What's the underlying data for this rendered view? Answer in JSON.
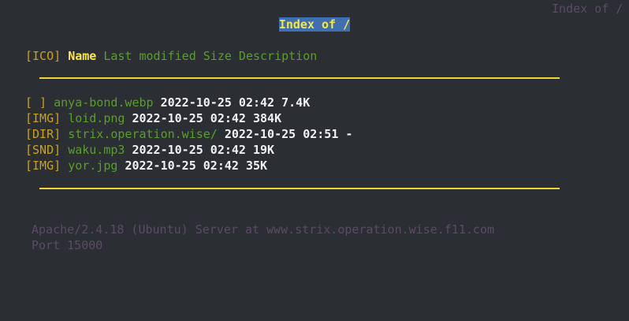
{
  "tab_title": "Index of /",
  "heading": "Index of /",
  "columns": {
    "icon": "[ICO]",
    "name": "Name",
    "rest": "Last modified Size Description"
  },
  "entries": [
    {
      "icon": "[ ]",
      "name": "anya-bond.webp",
      "modified": "2022-10-25 02:42",
      "size": "7.4K"
    },
    {
      "icon": "[IMG]",
      "name": "loid.png",
      "modified": "2022-10-25 02:42",
      "size": "384K"
    },
    {
      "icon": "[DIR]",
      "name": "strix.operation.wise/",
      "modified": "2022-10-25 02:51",
      "size": "-"
    },
    {
      "icon": "[SND]",
      "name": "waku.mp3",
      "modified": "2022-10-25 02:42",
      "size": "19K"
    },
    {
      "icon": "[IMG]",
      "name": "yor.jpg",
      "modified": "2022-10-25 02:42",
      "size": "35K"
    }
  ],
  "footer": {
    "line1": "Apache/2.4.18 (Ubuntu) Server at www.strix.operation.wise.f11.com",
    "line2": "Port 15000"
  },
  "colors": {
    "background": "#2b2e33",
    "heading_bg": "#3f6fb0",
    "heading_fg": "#f5e642",
    "link_green": "#5a9e2b",
    "icon_gold": "#c9a21c",
    "rule_yellow": "#f0d43a",
    "footer_purple": "#5c4a66"
  }
}
